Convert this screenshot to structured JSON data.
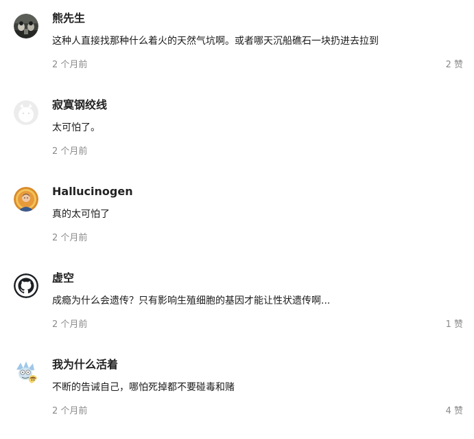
{
  "comments": [
    {
      "author": "熊先生",
      "content": "这种人直接找那种什么着火的天然气坑啊。或者哪天沉船礁石一块扔进去拉到",
      "time": "2 个月前",
      "likes": "2 赞",
      "avatar_icon": "photo-avatar"
    },
    {
      "author": "寂寞钢绞线",
      "content": "太可怕了。",
      "time": "2 个月前",
      "likes": "",
      "avatar_icon": "default-user-avatar"
    },
    {
      "author": "Hallucinogen",
      "content": "真的太可怕了",
      "time": "2 个月前",
      "likes": "",
      "avatar_icon": "portrait-avatar"
    },
    {
      "author": "虚空",
      "content": "成瘾为什么会遗传？只有影响生殖细胞的基因才能让性状遗传啊...",
      "time": "2 个月前",
      "likes": "1 赞",
      "avatar_icon": "github-octocat-avatar"
    },
    {
      "author": "我为什么活着",
      "content": "不断的告诫自己，哪怕死掉都不要碰毒和赌",
      "time": "2 个月前",
      "likes": "4 赞",
      "avatar_icon": "cartoon-avatar"
    }
  ],
  "colors": {
    "author": "#222222",
    "content": "#1a1a1a",
    "meta": "#8a8a8a",
    "background": "#ffffff"
  }
}
